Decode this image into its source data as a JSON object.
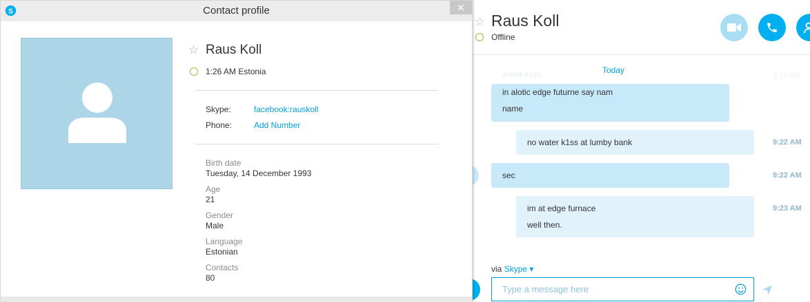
{
  "profile_window": {
    "title": "Contact profile",
    "close_glyph": "✕",
    "name": "Raus Koll",
    "local_time": "1:26 AM Estonia",
    "skype_label": "Skype:",
    "skype_value": "facebook:rauskoll",
    "phone_label": "Phone:",
    "phone_value": "Add Number",
    "fields": [
      {
        "label": "Birth date",
        "value": "Tuesday, 14 December 1993"
      },
      {
        "label": "Age",
        "value": "21"
      },
      {
        "label": "Gender",
        "value": "Male"
      },
      {
        "label": "Language",
        "value": "Estonian"
      },
      {
        "label": "Contacts",
        "value": "80"
      }
    ]
  },
  "chat": {
    "contact_name": "Raus Koll",
    "status": "Offline",
    "day_separator": "Today",
    "faded_message": "water k1ss",
    "faded_time": "9:22 AM",
    "messages": [
      {
        "direction": "incoming",
        "lines": [
          "in alotic edge futurne say nam",
          "name"
        ],
        "time": ""
      },
      {
        "direction": "outgoing",
        "lines": [
          "no water k1ss at lumby bank"
        ],
        "time": "9:22 AM"
      },
      {
        "direction": "incoming",
        "lines": [
          "sec"
        ],
        "time": "9:22 AM"
      },
      {
        "direction": "outgoing",
        "lines": [
          "im at edge furnace",
          "well then."
        ],
        "time": "9:23 AM"
      }
    ],
    "via_prefix": "via",
    "via_service": "Skype",
    "composer_placeholder": "Type a message here"
  },
  "colors": {
    "accent": "#00aff0",
    "link": "#00a0dc",
    "bubble_incoming": "#c7e9f9",
    "bubble_outgoing": "#e1f2fb",
    "online_ring": "#8cc63f",
    "avatar_bg": "#acd6e8"
  },
  "icons": {
    "app": "skype-icon",
    "video_call": "video-camera-icon",
    "audio_call": "phone-icon",
    "add_contact": "add-person-icon",
    "favorite": "star-icon",
    "emoji": "smiley-icon",
    "send": "send-icon",
    "close": "close-icon"
  }
}
